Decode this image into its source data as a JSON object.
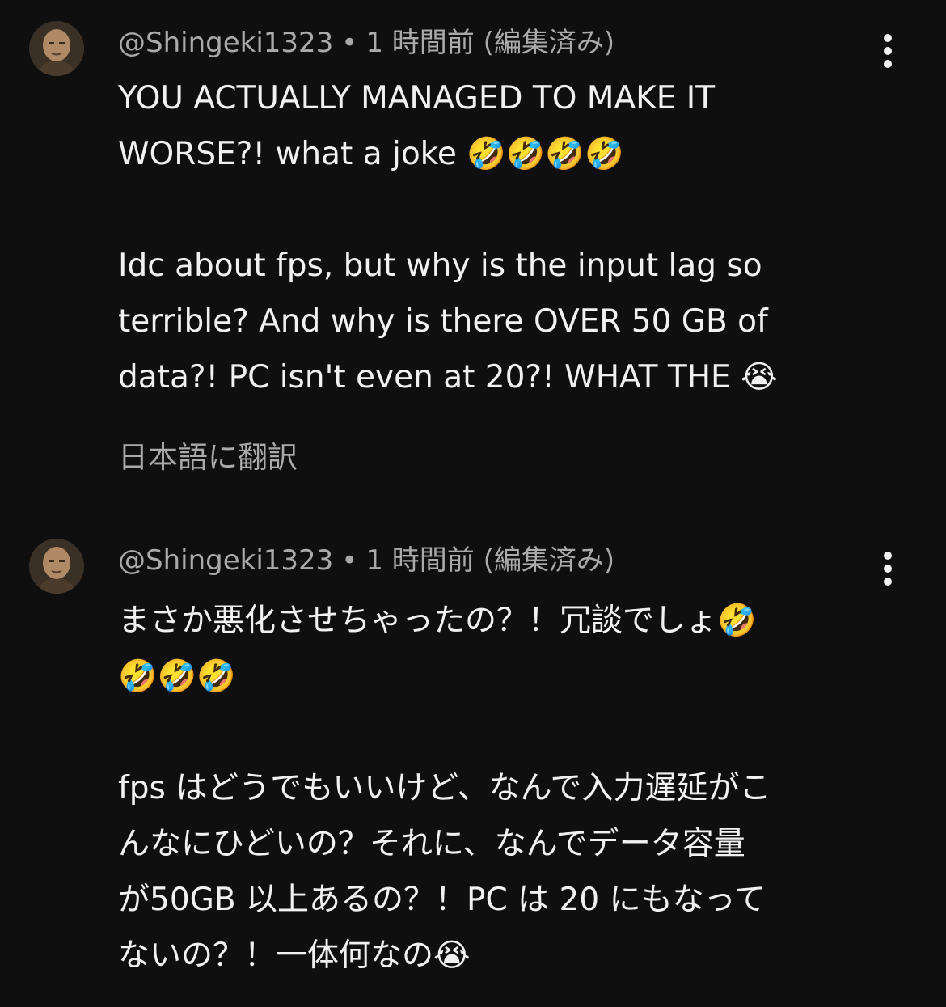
{
  "comments": [
    {
      "handle": "@Shingeki1323",
      "separator": "•",
      "time": "1 時間前",
      "edited": "(編集済み)",
      "body_lines": [
        "YOU ACTUALLY MANAGED TO MAKE IT",
        "WORSE?! what a joke 🤣🤣🤣🤣",
        "",
        "Idc about fps, but why is the input lag so",
        "terrible? And why is there OVER 50 GB of",
        "data?! PC isn't even at 20?! WHAT THE 😭"
      ],
      "translate_label": "日本語に翻訳"
    },
    {
      "handle": "@Shingeki1323",
      "separator": "•",
      "time": "1 時間前",
      "edited": "(編集済み)",
      "body_lines": [
        "まさか悪化させちゃったの？！冗談でしょ🤣",
        "🤣🤣🤣",
        "",
        "fps はどうでもいいけど、なんで入力遅延がこ",
        "んなにひどいの？それに、なんでデータ容量",
        "が50GB 以上あるの？！PC は 20 にもなって",
        "ないの？！一体何なの😭"
      ]
    }
  ],
  "icons": {
    "menu": "more-vert-icon",
    "avatar": "user-avatar"
  },
  "colors": {
    "background": "#0f0f0f",
    "text_primary": "#f1f1f1",
    "text_secondary": "#aaaaaa"
  }
}
